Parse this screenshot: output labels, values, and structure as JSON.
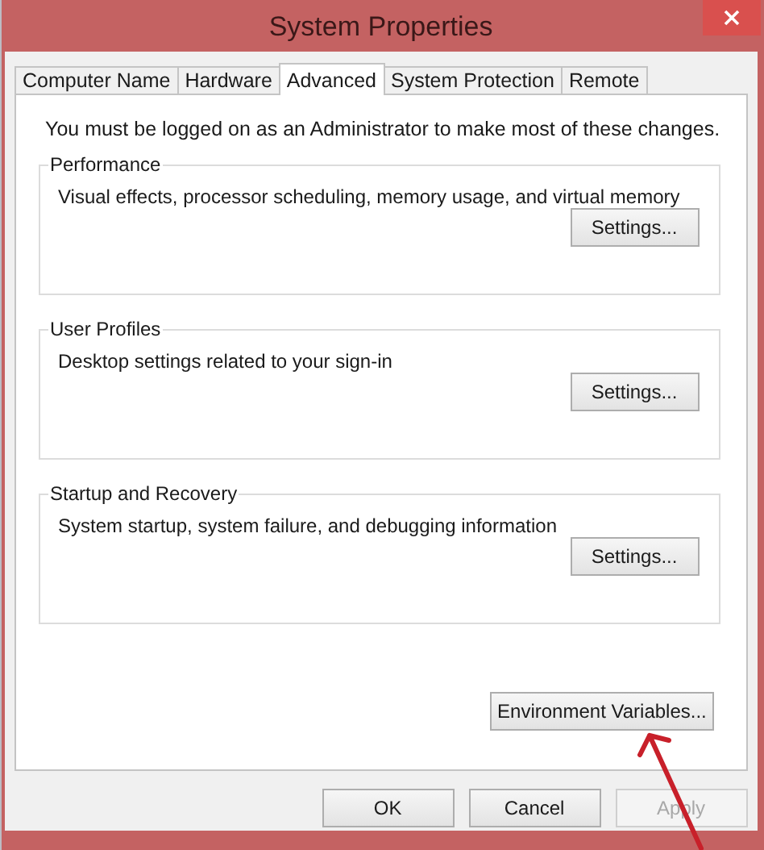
{
  "window": {
    "title": "System Properties"
  },
  "tabs": [
    {
      "label": "Computer Name",
      "selected": false
    },
    {
      "label": "Hardware",
      "selected": false
    },
    {
      "label": "Advanced",
      "selected": true
    },
    {
      "label": "System Protection",
      "selected": false
    },
    {
      "label": "Remote",
      "selected": false
    }
  ],
  "notice": "You must be logged on as an Administrator to make most of these changes.",
  "groups": [
    {
      "title": "Performance",
      "description": "Visual effects, processor scheduling, memory usage, and virtual memory",
      "button": "Settings..."
    },
    {
      "title": "User Profiles",
      "description": "Desktop settings related to your sign-in",
      "button": "Settings..."
    },
    {
      "title": "Startup and Recovery",
      "description": "System startup, system failure, and debugging information",
      "button": "Settings..."
    }
  ],
  "environment_button": "Environment Variables...",
  "buttons": [
    {
      "label": "OK",
      "disabled": false
    },
    {
      "label": "Cancel",
      "disabled": false
    },
    {
      "label": "Apply",
      "disabled": true
    }
  ]
}
